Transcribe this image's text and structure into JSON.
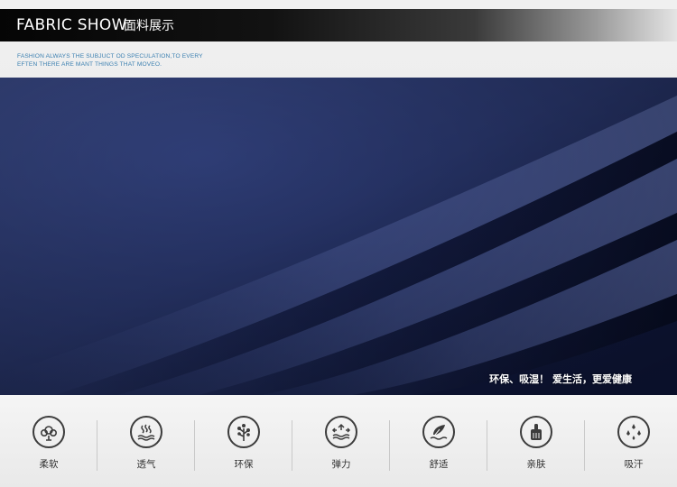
{
  "header": {
    "title": "FABRIC SHOW",
    "subtitle": "面料展示"
  },
  "tagline": {
    "line1": "FASHION ALWAYS THE  SUBJUCT OD SPECULATION,TO EVERY",
    "line2": "EFTEN THERE ARE MANT THINGS THAT MOVEO."
  },
  "fabric": {
    "slogan": "环保、吸湿！ 爱生活，更爱健康",
    "color": "#2d3b73"
  },
  "features": [
    {
      "label": "柔软",
      "icon": "cotton-icon"
    },
    {
      "label": "透气",
      "icon": "breathable-icon"
    },
    {
      "label": "环保",
      "icon": "tree-icon"
    },
    {
      "label": "弹力",
      "icon": "elastic-icon"
    },
    {
      "label": "舒适",
      "icon": "feather-icon"
    },
    {
      "label": "亲肤",
      "icon": "hand-icon"
    },
    {
      "label": "吸汗",
      "icon": "drops-icon"
    }
  ]
}
